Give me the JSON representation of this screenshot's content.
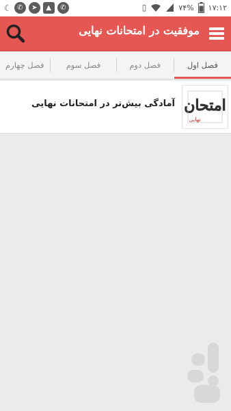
{
  "status_bar": {
    "time": "۱۷:۱۲",
    "battery": "۷۴%",
    "icons": [
      "wifi-icon",
      "signal-icon",
      "battery-icon",
      "phone-icon",
      "image-icon",
      "telegram-icon",
      "whatsapp-icon",
      "moon-icon"
    ]
  },
  "app_bar": {
    "title": "موفقیت در امتحانات نهایی",
    "icons": [
      "search-icon",
      "menu-icon"
    ],
    "background": "#e55753"
  },
  "tabs": [
    {
      "label": "فصل اول",
      "active": true
    },
    {
      "label": "فصل دوم",
      "active": false
    },
    {
      "label": "فصل سوم",
      "active": false
    },
    {
      "label": "فصل چهارم",
      "active": false
    }
  ],
  "list": [
    {
      "title": "آمادگی بیش‌تر در امتحانات نهایی",
      "thumb_text": "امتحان",
      "thumb_subtext": "نهایی"
    }
  ]
}
